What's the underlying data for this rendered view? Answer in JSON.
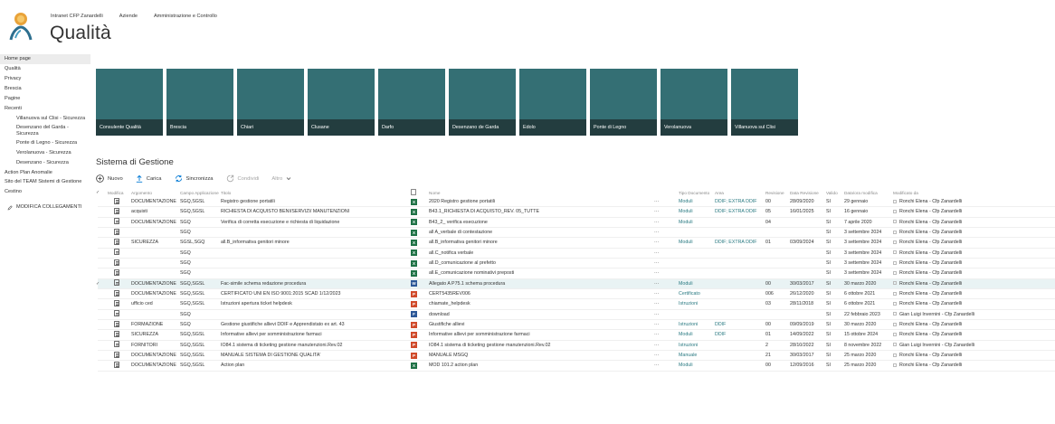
{
  "topnav": [
    "Intranet CFP Zanardelli",
    "Aziende",
    "Amministrazione e Controllo"
  ],
  "site_title": "Qualità",
  "leftnav": [
    {
      "label": "Home page",
      "active": true,
      "sub": false
    },
    {
      "label": "Qualità",
      "sub": false
    },
    {
      "label": "Privacy",
      "sub": false
    },
    {
      "label": "Brescia",
      "sub": false
    },
    {
      "label": "Pagine",
      "sub": false
    },
    {
      "label": "Recenti",
      "sub": false
    },
    {
      "label": "Villanuova sul Clisi - Sicurezza",
      "sub": true
    },
    {
      "label": "Desenzano del Garda - Sicurezza",
      "sub": true
    },
    {
      "label": "Ponte di Legno - Sicurezza",
      "sub": true
    },
    {
      "label": "Verolanuova - Sicurezza",
      "sub": true
    },
    {
      "label": "Desenzano - Sicurezza",
      "sub": true
    },
    {
      "label": "Action Plan Anomalie",
      "sub": false
    },
    {
      "label": "Sito del TEAM Sistemi di Gestione",
      "sub": false
    },
    {
      "label": "Cestino",
      "sub": false
    }
  ],
  "leftnav_edit": "MODIFICA COLLEGAMENTI",
  "tiles": [
    "Consulente Qualità",
    "Brescia",
    "Chiari",
    "Clusane",
    "Darfo",
    "Desenzano de Garda",
    "Edolo",
    "Ponte di Legno",
    "Verolanuova",
    "Villanuova sul Clisi"
  ],
  "section_title": "Sistema di Gestione",
  "toolbar": {
    "new": "Nuovo",
    "upload": "Carica",
    "sync": "Sincronizza",
    "share": "Condividi",
    "more": "Altro"
  },
  "columns": {
    "modifica": "Modifica",
    "argomento": "Argomento",
    "campo": "Campo Applicazione",
    "titolo": "Titolo",
    "nome": "Nome",
    "tipo": "Tipo Documento",
    "area": "Area",
    "revisione": "Revisione",
    "data_revisione": "Data Revisione",
    "valido": "Valido",
    "data_modifica": "Data/ora modifica",
    "modificato_da": "Modificato da"
  },
  "rows": [
    {
      "arg": "DOCUMENTAZIONE",
      "campo": "SGQ,SGSL",
      "titolo": "Registro gestione portatili",
      "icon": "x",
      "nome": "2020 Registro gestione portatili",
      "dots": "···",
      "tipo": "Moduli",
      "area": "DDIF; EXTRA DDIF",
      "rev": "00",
      "data": "28/09/2020",
      "valido": "SI",
      "dmod": "29 gennaio",
      "by": "Ronchi Elena - Cfp Zanardelli"
    },
    {
      "arg": "acquisti",
      "campo": "SGQ,SGSL",
      "titolo": "RICHIESTA DI ACQUISTO BENI/SERVIZI/ MANUTENZIONI",
      "icon": "x",
      "nome": "B43.1_RICHIESTA DI ACQUISTO_REV. 05_TUTTE",
      "dots": "···",
      "tipo": "Moduli",
      "area": "DDIF; EXTRA DDIF",
      "rev": "05",
      "data": "16/01/2025",
      "valido": "SI",
      "dmod": "16 gennaio",
      "by": "Ronchi Elena - Cfp Zanardelli"
    },
    {
      "arg": "DOCUMENTAZIONE",
      "campo": "SGQ",
      "titolo": "Verifica di corretta esecuzione e richiesta di liquidazione",
      "icon": "x",
      "nome": "B43_2_ verifica esecuzione",
      "dots": "···",
      "tipo": "Moduli",
      "area": "",
      "rev": "04",
      "data": "",
      "valido": "SI",
      "dmod": "7 aprile 2020",
      "by": "Ronchi Elena - Cfp Zanardelli"
    },
    {
      "arg": "",
      "campo": "SGQ",
      "titolo": "",
      "icon": "x",
      "nome": "all A_verbale di contestazione",
      "dots": "···",
      "tipo": "",
      "area": "",
      "rev": "",
      "data": "",
      "valido": "SI",
      "dmod": "3 settembre 2024",
      "by": "Ronchi Elena - Cfp Zanardelli"
    },
    {
      "arg": "SICUREZZA",
      "campo": "SGSL,SGQ",
      "titolo": "all.B_informativa genitori minore",
      "icon": "x",
      "nome": "all.B_informativa genitori minore",
      "dots": "···",
      "tipo": "Moduli",
      "area": "DDIF; EXTRA DDIF",
      "rev": "01",
      "data": "03/09/2024",
      "valido": "SI",
      "dmod": "3 settembre 2024",
      "by": "Ronchi Elena - Cfp Zanardelli"
    },
    {
      "arg": "",
      "campo": "SGQ",
      "titolo": "",
      "icon": "x",
      "nome": "all.C_notifica verbale",
      "dots": "···",
      "tipo": "",
      "area": "",
      "rev": "",
      "data": "",
      "valido": "SI",
      "dmod": "3 settembre 2024",
      "by": "Ronchi Elena - Cfp Zanardelli"
    },
    {
      "arg": "",
      "campo": "SGQ",
      "titolo": "",
      "icon": "x",
      "nome": "all.D_comunicazione al prefetto",
      "dots": "···",
      "tipo": "",
      "area": "",
      "rev": "",
      "data": "",
      "valido": "SI",
      "dmod": "3 settembre 2024",
      "by": "Ronchi Elena - Cfp Zanardelli"
    },
    {
      "arg": "",
      "campo": "SGQ",
      "titolo": "",
      "icon": "x",
      "nome": "all.E_comunicazione nominativi preposti",
      "dots": "···",
      "tipo": "",
      "area": "",
      "rev": "",
      "data": "",
      "valido": "SI",
      "dmod": "3 settembre 2024",
      "by": "Ronchi Elena - Cfp Zanardelli"
    },
    {
      "arg": "DOCUMENTAZIONE",
      "campo": "SGQ,SGSL",
      "titolo": "Fac-simile schema redazione procedura",
      "icon": "d",
      "nome": "Allegato A P75.1 schema procedura",
      "dots": "···",
      "tipo": "Moduli",
      "area": "",
      "rev": "00",
      "data": "30/03/2017",
      "valido": "SI",
      "dmod": "30 marzo 2020",
      "by": "Ronchi Elena - Cfp Zanardelli",
      "sel": true
    },
    {
      "arg": "DOCUMENTAZIONE",
      "campo": "SGQ,SGSL",
      "titolo": "CERTIFICATO UNI EN ISO 9001:2015 SCAD 1/12/2023",
      "icon": "p",
      "nome": "CERT5435REV006",
      "dots": "···",
      "tipo": "Certificato",
      "area": "",
      "rev": "006",
      "data": "26/12/2020",
      "valido": "SI",
      "dmod": "6 ottobre 2021",
      "by": "Ronchi Elena - Cfp Zanardelli"
    },
    {
      "arg": "ufficio ced",
      "campo": "SGQ,SGSL",
      "titolo": "Istruzioni apertura ticket helpdesk",
      "icon": "p",
      "nome": "chiamate_helpdesk",
      "dots": "···",
      "tipo": "Istruzioni",
      "area": "",
      "rev": "03",
      "data": "28/11/2018",
      "valido": "SI",
      "dmod": "6 ottobre 2021",
      "by": "Ronchi Elena - Cfp Zanardelli"
    },
    {
      "arg": "",
      "campo": "SGQ",
      "titolo": "",
      "icon": "f",
      "nome": "download",
      "dots": "···",
      "tipo": "",
      "area": "",
      "rev": "",
      "data": "",
      "valido": "SI",
      "dmod": "22 febbraio 2023",
      "by": "Gian Luigi Invernini - Cfp Zanardelli"
    },
    {
      "arg": "FORMAZIONE",
      "campo": "SGQ",
      "titolo": "Gestione giustifiche allievi DDIF e Apprendistato ex art. 43",
      "icon": "p",
      "nome": "Giustifiche allievi",
      "dots": "···",
      "tipo": "Istruzioni",
      "area": "DDIF",
      "rev": "00",
      "data": "09/09/2019",
      "valido": "SI",
      "dmod": "30 marzo 2020",
      "by": "Ronchi Elena - Cfp Zanardelli"
    },
    {
      "arg": "SICUREZZA",
      "campo": "SGQ,SGSL",
      "titolo": "Informative allievi per somministrazione farmaci",
      "icon": "p",
      "nome": "Informative allievi per somministrazione farmaci",
      "dots": "···",
      "tipo": "Moduli",
      "area": "DDIF",
      "rev": "01",
      "data": "14/09/2022",
      "valido": "SI",
      "dmod": "15 ottobre 2024",
      "by": "Ronchi Elena - Cfp Zanardelli"
    },
    {
      "arg": "FORNITORI",
      "campo": "SGQ,SGSL",
      "titolo": "IO84.1 sistema di ticketing gestione manutenzioni.Rev.02",
      "icon": "p",
      "nome": "IO84.1 sistema di ticketing gestione manutenzioni.Rev.02",
      "dots": "···",
      "tipo": "Istruzioni",
      "area": "",
      "rev": "2",
      "data": "28/10/2022",
      "valido": "SI",
      "dmod": "8 novembre 2022",
      "by": "Gian Luigi Invernini - Cfp Zanardelli"
    },
    {
      "arg": "DOCUMENTAZIONE",
      "campo": "SGQ,SGSL",
      "titolo": "MANUALE SISTEMA DI GESTIONE QUALITA'",
      "icon": "p",
      "nome": "MANUALE MSGQ",
      "dots": "···",
      "tipo": "Manuale",
      "area": "",
      "rev": "21",
      "data": "30/03/2017",
      "valido": "SI",
      "dmod": "25 marzo 2020",
      "by": "Ronchi Elena - Cfp Zanardelli"
    },
    {
      "arg": "DOCUMENTAZIONE",
      "campo": "SGQ,SGSL",
      "titolo": "Action plan",
      "icon": "x",
      "nome": "MOD 101.2 action plan",
      "dots": "···",
      "tipo": "Moduli",
      "area": "",
      "rev": "00",
      "data": "12/09/2016",
      "valido": "SI",
      "dmod": "25 marzo 2020",
      "by": "Ronchi Elena - Cfp Zanardelli"
    }
  ],
  "colors": {
    "tile": "#346f74",
    "tile_label": "#233d3f",
    "link": "#2a7a82",
    "accent": "#0078d4"
  }
}
